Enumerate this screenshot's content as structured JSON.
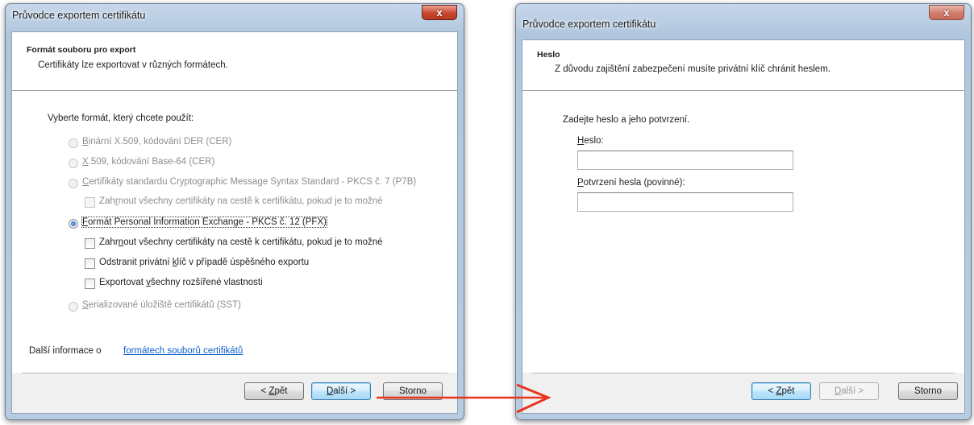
{
  "left_window": {
    "title": "Průvodce exportem certifikátu",
    "close_label": "x",
    "header": {
      "title": "Formát souboru pro export",
      "subtitle": "Certifikáty lze exportovat v různých formátech."
    },
    "prompt": "Vyberte formát, který chcete použít:",
    "options": {
      "der_pre": "",
      "der_key": "B",
      "der_post": "inární X.509, kódování DER (CER)",
      "b64_pre": "",
      "b64_key": "X",
      "b64_post": ".509, kódování Base-64 (CER)",
      "p7b_pre": "",
      "p7b_key": "C",
      "p7b_post": "ertifikáty standardu Cryptographic Message Syntax Standard - PKCS č. 7 (P7B)",
      "p7b_include_pre": "Zah",
      "p7b_include_key": "r",
      "p7b_include_post": "nout všechny certifikáty na cestě k certifikátu, pokud je to možné",
      "pfx_pre": "",
      "pfx_key": "F",
      "pfx_post": "ormát Personal Information Exchange - PKCS č. 12 (PFX)",
      "pfx_include_pre": "Zahr",
      "pfx_include_key": "n",
      "pfx_include_post": "out všechny certifikáty na cestě k certifikátu, pokud je to možné",
      "pfx_delete_pre": "Odstranit privátní ",
      "pfx_delete_key": "k",
      "pfx_delete_post": "líč v případě úspěšného exportu",
      "pfx_export_pre": "Exportovat ",
      "pfx_export_key": "v",
      "pfx_export_post": "šechny rozšířené vlastnosti",
      "sst_pre": "",
      "sst_key": "S",
      "sst_post": "erializované úložiště certifikátů (SST)"
    },
    "more_info_text": "Další informace o ",
    "more_info_link": "formátech souborů certifikátů",
    "buttons": {
      "back_pre": "< ",
      "back_key": "Z",
      "back_post": "pět",
      "next_pre": "",
      "next_key": "D",
      "next_post": "alší >",
      "cancel": "Storno"
    },
    "selected_format": "pfx"
  },
  "right_window": {
    "title": "Průvodce exportem certifikátu",
    "close_label": "x",
    "header": {
      "title": "Heslo",
      "subtitle": "Z důvodu zajištění zabezpečení musíte privátní klíč chránit heslem."
    },
    "prompt": "Zadejte heslo a jeho potvrzení.",
    "password_label_key": "H",
    "password_label_post": "eslo:",
    "password_value": "",
    "confirm_label_key": "P",
    "confirm_label_post": "otvrzení hesla (povinné):",
    "confirm_value": "",
    "buttons": {
      "back_pre": "< ",
      "back_key": "Z",
      "back_post": "pět",
      "next_pre": "",
      "next_key": "D",
      "next_post": "alší >",
      "cancel": "Storno"
    }
  },
  "colors": {
    "arrow": "#e8351e",
    "link": "#0e5fcc",
    "titlebar": "#c6d7ea"
  }
}
